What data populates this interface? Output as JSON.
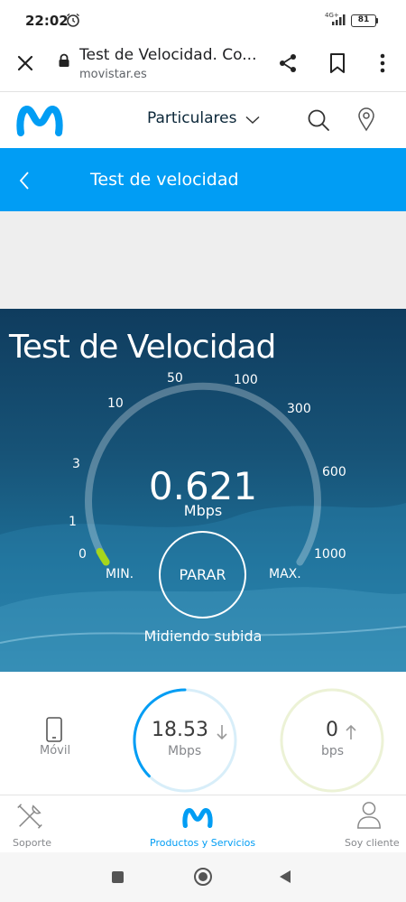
{
  "status_bar": {
    "time": "22:02",
    "network": "4G+",
    "battery": "81",
    "icons": [
      "alarm-icon",
      "signal-icon",
      "battery-icon"
    ]
  },
  "browser": {
    "title": "Test de Velocidad. Co...",
    "url": "movistar.es",
    "icons": [
      "close-icon",
      "lock-icon",
      "share-icon",
      "bookmark-icon",
      "more-icon"
    ]
  },
  "header": {
    "logo": "movistar-logo",
    "menu_label": "Particulares",
    "icons": [
      "chevron-down-icon",
      "search-icon",
      "location-pin-icon"
    ]
  },
  "page_bar": {
    "title": "Test de velocidad",
    "icon": "back-chevron-icon"
  },
  "speed_test": {
    "title": "Test de Velocidad",
    "scale": [
      "0",
      "1",
      "3",
      "10",
      "50",
      "100",
      "300",
      "600",
      "1000"
    ],
    "current_value": "0.621",
    "current_unit": "Mbps",
    "min_label": "MIN.",
    "max_label": "MAX.",
    "stop_label": "PARAR",
    "status": "Midiendo subida"
  },
  "results": {
    "device_label": "Móvil",
    "download": {
      "value": "18.53",
      "unit": "Mbps",
      "progress": 0.5
    },
    "upload": {
      "value": "0",
      "unit": "bps",
      "progress": 0
    }
  },
  "bottom_nav": {
    "items": [
      {
        "label": "Soporte",
        "icon": "tools-icon",
        "active": false
      },
      {
        "label": "Productos y Servicios",
        "icon": "movistar-m-icon",
        "active": true
      },
      {
        "label": "Soy cliente",
        "icon": "user-icon",
        "active": false
      }
    ]
  },
  "colors": {
    "brand_blue": "#019df4",
    "panel_dark": "#0f3c5e",
    "gauge_progress": "#a6d61c"
  }
}
